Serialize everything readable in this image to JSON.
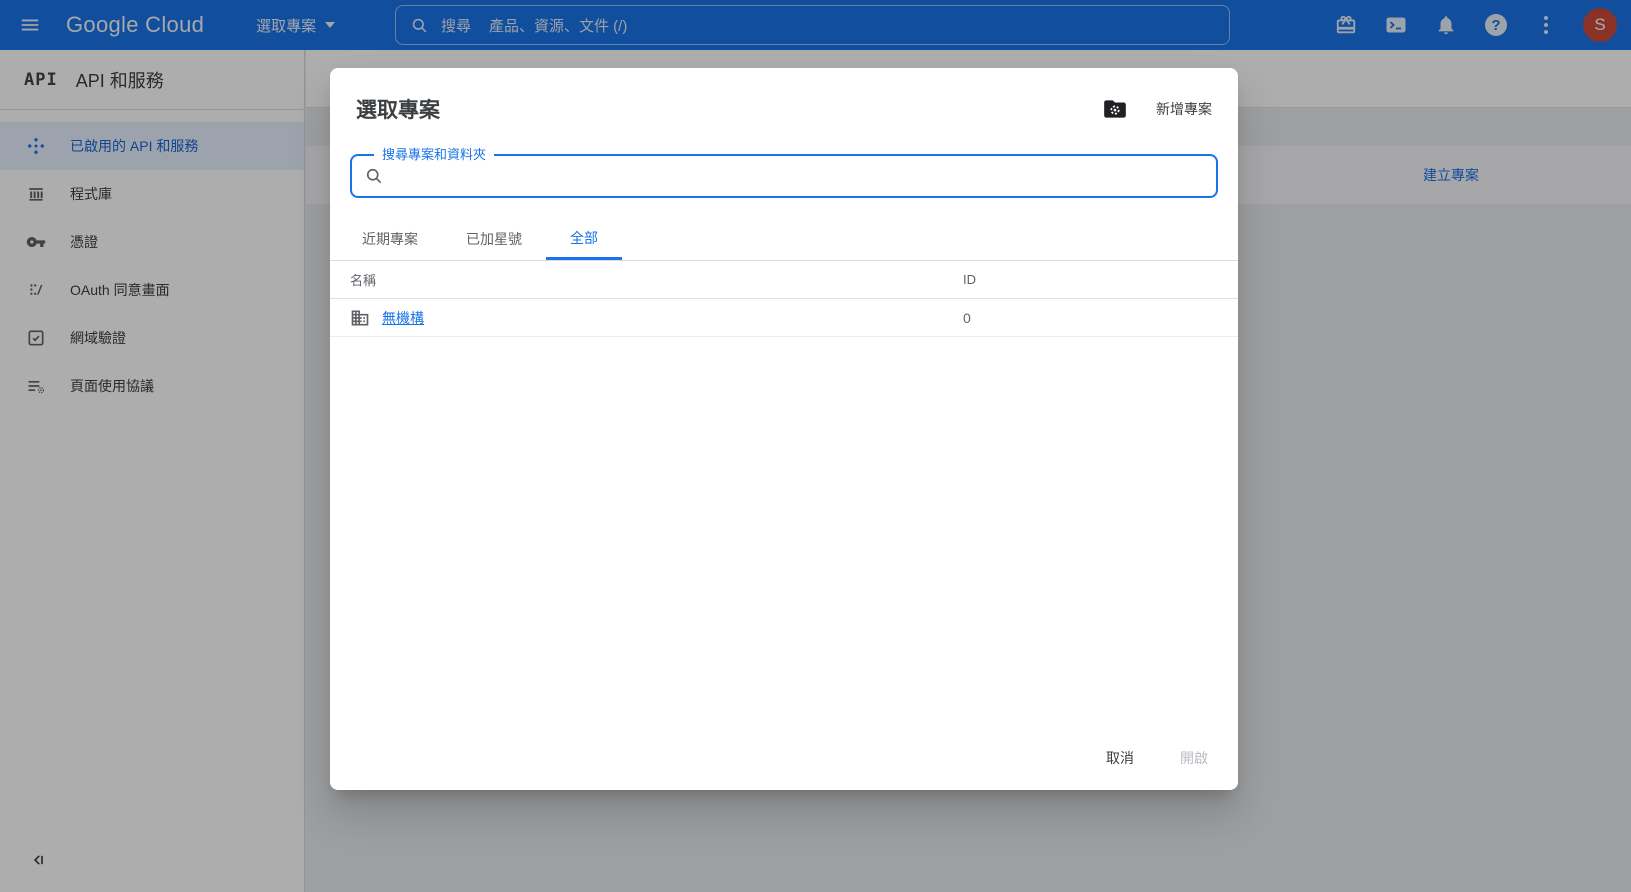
{
  "topbar": {
    "logo": "Google Cloud",
    "project_picker_label": "選取專案",
    "search_prefix": "搜尋",
    "search_placeholder": "產品、資源、文件 (/)",
    "avatar_initial": "S"
  },
  "sidebar": {
    "product_badge": "API",
    "title": "API 和服務",
    "items": [
      {
        "label": "已啟用的 API 和服務",
        "icon": "enabled-apis-icon",
        "selected": true
      },
      {
        "label": "程式庫",
        "icon": "library-icon",
        "selected": false
      },
      {
        "label": "憑證",
        "icon": "key-icon",
        "selected": false
      },
      {
        "label": "OAuth 同意畫面",
        "icon": "oauth-consent-icon",
        "selected": false
      },
      {
        "label": "網域驗證",
        "icon": "domain-verification-icon",
        "selected": false
      },
      {
        "label": "頁面使用協議",
        "icon": "page-usage-icon",
        "selected": false
      }
    ]
  },
  "background": {
    "create_project_label": "建立專案"
  },
  "modal": {
    "title": "選取專案",
    "new_project_label": "新增專案",
    "search_label": "搜尋專案和資料夾",
    "search_value": "",
    "tabs": [
      {
        "label": "近期專案",
        "active": false
      },
      {
        "label": "已加星號",
        "active": false
      },
      {
        "label": "全部",
        "active": true
      }
    ],
    "table": {
      "columns": [
        "名稱",
        "ID"
      ],
      "rows": [
        {
          "name": "無機構",
          "id": "0"
        }
      ]
    },
    "cancel_label": "取消",
    "open_label": "開啟"
  },
  "colors": {
    "accent": "#1a73e8",
    "topbar": "#1a73e8",
    "avatar": "#cc4b3b",
    "selected_item_bg": "#e8f0fe",
    "selected_item_fg": "#1967d2"
  }
}
